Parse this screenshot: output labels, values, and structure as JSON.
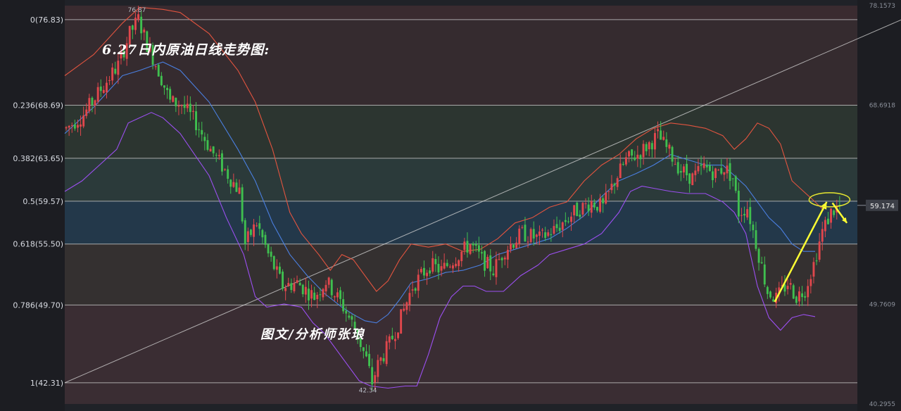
{
  "title": "6.27日内原油日线走势图:",
  "author": "图文/分析师张琅",
  "colors": {
    "background": "#202228",
    "plot_bg": "#2a2b30",
    "up_candle": "#e0474c",
    "down_candle": "#3fbf4f",
    "upper_band": "#e2543f",
    "middle_band": "#4a7fe0",
    "lower_band": "#9b4ff0",
    "fib_line": "#c8c8c8",
    "trend_line": "#d8d8d8",
    "arrow": "#ffff33",
    "current_tag": "#3c3f47"
  },
  "chart_data": {
    "type": "candlestick",
    "instrument": "原油",
    "timeframe": "日线",
    "y_range": [
      40.2955,
      78.1573
    ],
    "right_axis_ticks": [
      "78.1573",
      "68.6918",
      "49.7609",
      "40.2955"
    ],
    "current_price": "59.174",
    "swing_high_label": "76.87",
    "swing_low_label": "42.34",
    "fibonacci_levels": [
      {
        "ratio": "0",
        "price": 76.83,
        "label": "0(76.83)"
      },
      {
        "ratio": "0.236",
        "price": 68.69,
        "label": "0.236(68.69)"
      },
      {
        "ratio": "0.382",
        "price": 63.65,
        "label": "0.382(63.65)"
      },
      {
        "ratio": "0.5",
        "price": 59.57,
        "label": "0.5(59.57)"
      },
      {
        "ratio": "0.618",
        "price": 55.5,
        "label": "0.618(55.50)"
      },
      {
        "ratio": "0.786",
        "price": 49.7,
        "label": "0.786(49.70)"
      },
      {
        "ratio": "1",
        "price": 42.31,
        "label": "1(42.31)"
      }
    ],
    "fibonacci_zone_colors": [
      "#3a2b30",
      "#352b2f",
      "#2c3530",
      "#2b3a3a",
      "#23384a",
      "#343030",
      "#3a2d33"
    ],
    "price_path": [
      [
        0,
        66.5
      ],
      [
        6,
        67.8
      ],
      [
        12,
        70.2
      ],
      [
        18,
        72.5
      ],
      [
        22,
        75.5
      ],
      [
        25,
        76.87
      ],
      [
        28,
        74.5
      ],
      [
        32,
        72.0
      ],
      [
        36,
        69.0
      ],
      [
        40,
        68.8
      ],
      [
        45,
        67.0
      ],
      [
        50,
        64.5
      ],
      [
        55,
        62.5
      ],
      [
        60,
        60.5
      ],
      [
        62,
        55.5
      ],
      [
        66,
        57.5
      ],
      [
        70,
        54.5
      ],
      [
        75,
        51.5
      ],
      [
        80,
        51.8
      ],
      [
        86,
        50.5
      ],
      [
        90,
        52.0
      ],
      [
        95,
        50.0
      ],
      [
        100,
        47.5
      ],
      [
        104,
        44.5
      ],
      [
        106,
        42.34
      ],
      [
        108,
        44.0
      ],
      [
        112,
        46.0
      ],
      [
        116,
        48.5
      ],
      [
        120,
        51.5
      ],
      [
        126,
        53.5
      ],
      [
        130,
        53.0
      ],
      [
        136,
        54.5
      ],
      [
        140,
        55.5
      ],
      [
        144,
        54.0
      ],
      [
        148,
        53.0
      ],
      [
        152,
        55.0
      ],
      [
        158,
        56.5
      ],
      [
        164,
        56.0
      ],
      [
        170,
        57.0
      ],
      [
        176,
        58.5
      ],
      [
        182,
        59.5
      ],
      [
        186,
        59.0
      ],
      [
        190,
        61.5
      ],
      [
        194,
        63.5
      ],
      [
        198,
        64.0
      ],
      [
        202,
        65.0
      ],
      [
        205,
        65.8
      ],
      [
        209,
        64.2
      ],
      [
        213,
        62.5
      ],
      [
        217,
        61.8
      ],
      [
        221,
        62.8
      ],
      [
        225,
        62.2
      ],
      [
        228,
        62.8
      ],
      [
        231,
        61.8
      ],
      [
        233,
        58.5
      ],
      [
        236,
        59.0
      ],
      [
        240,
        54.5
      ],
      [
        243,
        51.0
      ],
      [
        246,
        50.3
      ],
      [
        250,
        51.8
      ],
      [
        253,
        50.5
      ],
      [
        256,
        51.2
      ],
      [
        259,
        53.6
      ],
      [
        262,
        56.7
      ],
      [
        265,
        58.5
      ],
      [
        268,
        59.1
      ]
    ],
    "upper_band_path": [
      [
        0,
        71.5
      ],
      [
        10,
        73.5
      ],
      [
        20,
        76.5
      ],
      [
        26,
        78.0
      ],
      [
        34,
        77.8
      ],
      [
        40,
        77.5
      ],
      [
        50,
        75.5
      ],
      [
        60,
        72.0
      ],
      [
        66,
        69.0
      ],
      [
        72,
        64.5
      ],
      [
        78,
        58.5
      ],
      [
        82,
        56.5
      ],
      [
        88,
        54.5
      ],
      [
        92,
        53.0
      ],
      [
        96,
        54.5
      ],
      [
        100,
        54.0
      ],
      [
        104,
        52.5
      ],
      [
        108,
        51.0
      ],
      [
        112,
        52.0
      ],
      [
        116,
        54.0
      ],
      [
        120,
        55.5
      ],
      [
        126,
        55.2
      ],
      [
        132,
        55.5
      ],
      [
        138,
        54.8
      ],
      [
        144,
        55.0
      ],
      [
        150,
        56.0
      ],
      [
        156,
        57.5
      ],
      [
        162,
        58.0
      ],
      [
        168,
        59.0
      ],
      [
        174,
        59.5
      ],
      [
        180,
        61.5
      ],
      [
        186,
        63.0
      ],
      [
        192,
        64.0
      ],
      [
        198,
        65.5
      ],
      [
        204,
        66.5
      ],
      [
        210,
        67.0
      ],
      [
        216,
        66.8
      ],
      [
        222,
        66.5
      ],
      [
        228,
        65.8
      ],
      [
        232,
        64.5
      ],
      [
        236,
        65.5
      ],
      [
        240,
        67.0
      ],
      [
        244,
        66.5
      ],
      [
        248,
        65.0
      ],
      [
        252,
        61.5
      ],
      [
        256,
        60.5
      ],
      [
        260,
        59.5
      ],
      [
        263,
        58.7
      ]
    ],
    "middle_band_path": [
      [
        0,
        66.0
      ],
      [
        10,
        68.5
      ],
      [
        20,
        71.5
      ],
      [
        26,
        72.0
      ],
      [
        34,
        72.8
      ],
      [
        40,
        72.0
      ],
      [
        50,
        69.0
      ],
      [
        60,
        64.5
      ],
      [
        66,
        61.5
      ],
      [
        72,
        57.5
      ],
      [
        78,
        54.5
      ],
      [
        84,
        52.5
      ],
      [
        90,
        50.8
      ],
      [
        96,
        49.5
      ],
      [
        100,
        48.8
      ],
      [
        104,
        48.2
      ],
      [
        108,
        48.0
      ],
      [
        112,
        48.8
      ],
      [
        116,
        50.2
      ],
      [
        120,
        51.8
      ],
      [
        126,
        52.2
      ],
      [
        132,
        52.8
      ],
      [
        138,
        53.0
      ],
      [
        144,
        53.5
      ],
      [
        150,
        54.5
      ],
      [
        156,
        55.0
      ],
      [
        162,
        55.5
      ],
      [
        168,
        56.0
      ],
      [
        174,
        57.0
      ],
      [
        180,
        58.2
      ],
      [
        186,
        60.0
      ],
      [
        192,
        61.5
      ],
      [
        198,
        62.2
      ],
      [
        204,
        63.0
      ],
      [
        210,
        64.0
      ],
      [
        216,
        63.5
      ],
      [
        222,
        63.0
      ],
      [
        228,
        63.0
      ],
      [
        232,
        62.0
      ],
      [
        236,
        61.0
      ],
      [
        240,
        59.5
      ],
      [
        244,
        58.0
      ],
      [
        248,
        57.0
      ],
      [
        252,
        55.5
      ],
      [
        256,
        54.8
      ],
      [
        260,
        54.8
      ]
    ],
    "lower_band_path": [
      [
        0,
        60.5
      ],
      [
        6,
        61.5
      ],
      [
        12,
        63.0
      ],
      [
        18,
        64.5
      ],
      [
        22,
        67.0
      ],
      [
        26,
        67.5
      ],
      [
        30,
        68.0
      ],
      [
        34,
        67.5
      ],
      [
        40,
        66.0
      ],
      [
        50,
        62.0
      ],
      [
        56,
        58.0
      ],
      [
        62,
        54.5
      ],
      [
        66,
        50.5
      ],
      [
        70,
        49.5
      ],
      [
        76,
        49.8
      ],
      [
        82,
        49.5
      ],
      [
        86,
        48.0
      ],
      [
        90,
        47.0
      ],
      [
        94,
        45.5
      ],
      [
        98,
        44.0
      ],
      [
        102,
        42.5
      ],
      [
        106,
        42.0
      ],
      [
        112,
        41.8
      ],
      [
        118,
        42.0
      ],
      [
        122,
        42.0
      ],
      [
        126,
        45.0
      ],
      [
        130,
        48.5
      ],
      [
        134,
        50.5
      ],
      [
        138,
        51.5
      ],
      [
        142,
        51.5
      ],
      [
        146,
        51.0
      ],
      [
        152,
        51.0
      ],
      [
        158,
        52.5
      ],
      [
        164,
        53.5
      ],
      [
        168,
        54.5
      ],
      [
        174,
        55.0
      ],
      [
        180,
        55.5
      ],
      [
        186,
        56.5
      ],
      [
        192,
        58.5
      ],
      [
        196,
        60.5
      ],
      [
        200,
        61.0
      ],
      [
        204,
        60.8
      ],
      [
        210,
        60.5
      ],
      [
        216,
        60.3
      ],
      [
        222,
        60.3
      ],
      [
        228,
        59.5
      ],
      [
        232,
        58.5
      ],
      [
        236,
        56.5
      ],
      [
        240,
        51.5
      ],
      [
        244,
        48.5
      ],
      [
        248,
        47.3
      ],
      [
        252,
        48.5
      ],
      [
        256,
        48.8
      ],
      [
        260,
        48.6
      ]
    ],
    "annotations": [
      {
        "type": "trend_line",
        "from": [
          0,
          42.31
        ],
        "to": [
          290,
          76.83
        ]
      },
      {
        "type": "arrow",
        "from": [
          246,
          50.0
        ],
        "to": [
          264,
          59.5
        ]
      },
      {
        "type": "ellipse",
        "center": [
          264,
          59.5
        ]
      },
      {
        "type": "arrow",
        "from": [
          266,
          59.4
        ],
        "to": [
          271,
          57.5
        ]
      }
    ]
  }
}
